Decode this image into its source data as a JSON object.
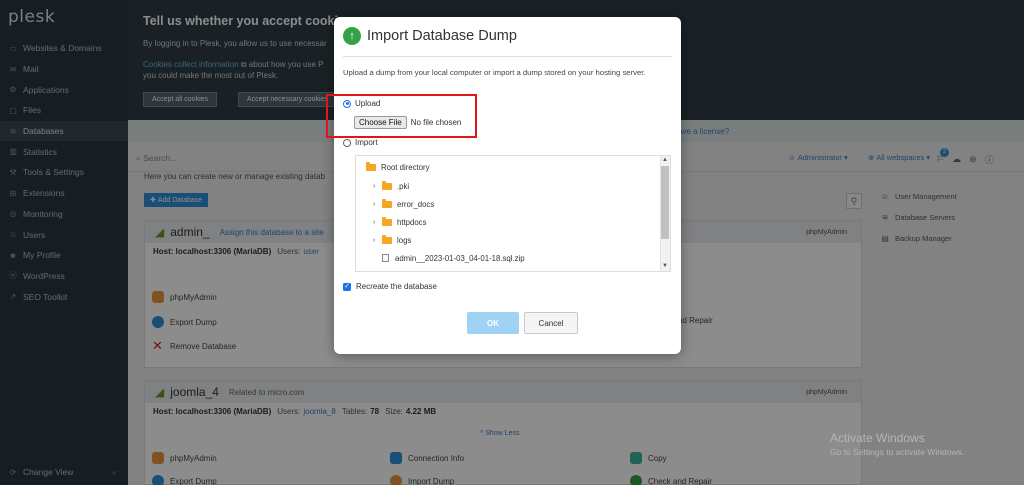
{
  "sidebar": {
    "logo": "plesk",
    "items": [
      {
        "label": "Websites & Domains",
        "icon": "monitor-icon",
        "glyph": "▭"
      },
      {
        "label": "Mail",
        "icon": "mail-icon",
        "glyph": "✉"
      },
      {
        "label": "Applications",
        "icon": "gear-icon",
        "glyph": "⚙"
      },
      {
        "label": "Files",
        "icon": "folder-icon",
        "glyph": "▢"
      },
      {
        "label": "Databases",
        "icon": "database-icon",
        "glyph": "≋"
      },
      {
        "label": "Statistics",
        "icon": "chart-icon",
        "glyph": "▥"
      },
      {
        "label": "Tools & Settings",
        "icon": "tools-icon",
        "glyph": "⚒"
      },
      {
        "label": "Extensions",
        "icon": "puzzle-icon",
        "glyph": "⊞"
      },
      {
        "label": "Monitoring",
        "icon": "monitoring-icon",
        "glyph": "◎"
      },
      {
        "label": "Users",
        "icon": "user-icon",
        "glyph": "☺"
      },
      {
        "label": "My Profile",
        "icon": "profile-icon",
        "glyph": "☻"
      },
      {
        "label": "WordPress",
        "icon": "wordpress-icon",
        "glyph": "ⓦ"
      },
      {
        "label": "SEO Toolkit",
        "icon": "seo-icon",
        "glyph": "↗"
      }
    ],
    "change_view": "Change View"
  },
  "banner": {
    "title": "Tell us whether you accept cookies",
    "text1": "By logging in to Plesk, you allow us to use necessar",
    "link": "Cookies collect information",
    "text2": " about how you use P",
    "text3": "you could make the most out of Plesk.",
    "accept_all": "Accept all cookies",
    "accept_necessary": "Accept necessary cookies"
  },
  "header": {
    "license": "ave a license?",
    "search_placeholder": "Search...",
    "user": "Administrator",
    "webspaces": "All webspaces",
    "notif_count": "2"
  },
  "main": {
    "intro": "Here you can create new or manage existing datab",
    "add_button": "Add Database",
    "db1": {
      "name": "admin_",
      "assign": "Assign this database to a site",
      "phpmyadmin": "phpMyAdmin",
      "host": "Host: localhost:3306 (MariaDB)",
      "users_label": "Users:",
      "users": "user",
      "actions": {
        "phpmyadmin": "phpMyAdmin",
        "export": "Export Dump",
        "remove": "Remove Database",
        "repair": "nd Repair"
      }
    },
    "db2": {
      "name": "joomla_4",
      "related": "Related to micro.com",
      "phpmyadmin": "phpMyAdmin",
      "host": "Host: localhost:3306 (MariaDB)",
      "users_label": "Users:",
      "users": "joomla_8",
      "tables_label": "Tables:",
      "tables": "78",
      "size_label": "Size:",
      "size": "4.22 MB",
      "show_less": "^ Show Less",
      "actions": {
        "phpmyadmin": "phpMyAdmin",
        "connection": "Connection Info",
        "copy": "Copy",
        "export": "Export Dump",
        "import": "Import Dump",
        "check": "Check and Repair"
      }
    },
    "right_panel": [
      {
        "label": "User Management",
        "glyph": "☺"
      },
      {
        "label": "Database Servers",
        "glyph": "≋"
      },
      {
        "label": "Backup Manager",
        "glyph": "▤"
      }
    ]
  },
  "watermark": {
    "title": "Activate Windows",
    "subtitle": "Go to Settings to activate Windows."
  },
  "modal": {
    "title": "Import Database Dump",
    "description": "Upload a dump from your local computer or import a dump stored on your hosting server.",
    "upload_label": "Upload",
    "choose_file": "Choose File",
    "no_file": "No file chosen",
    "import_label": "Import",
    "tree": {
      "root": "Root directory",
      "folders": [
        ".pki",
        "error_docs",
        "httpdocs",
        "logs"
      ],
      "file": "admin__2023-01-03_04-01-18.sql.zip"
    },
    "recreate_label": "Recreate the database",
    "ok": "OK",
    "cancel": "Cancel"
  },
  "colors": {
    "sidebar": "#2b3740",
    "accent": "#2f8fd8",
    "highlight": "#e0161c",
    "ok_disabled": "#9fd2f3",
    "title_icon": "#37a244"
  }
}
